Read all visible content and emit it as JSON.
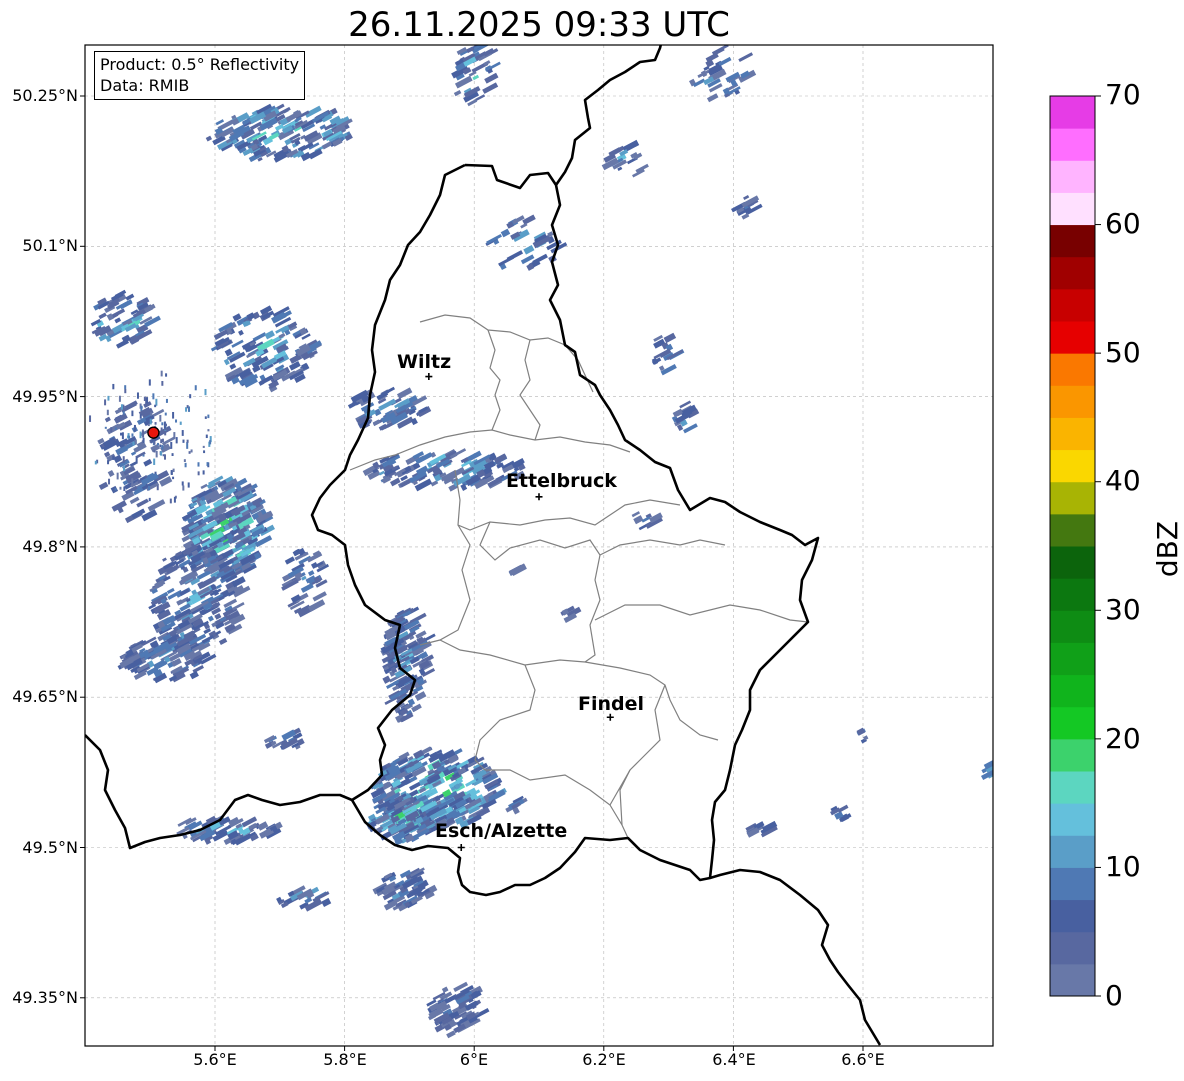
{
  "title": "26.11.2025 09:33 UTC",
  "info": {
    "product": "Product: 0.5° Reflectivity",
    "data": "Data: RMIB"
  },
  "axes": {
    "lat_ticks": [
      "50.25°N",
      "50.1°N",
      "49.95°N",
      "49.8°N",
      "49.65°N",
      "49.5°N",
      "49.35°N"
    ],
    "lon_ticks": [
      "5.6°E",
      "5.8°E",
      "6°E",
      "6.2°E",
      "6.4°E",
      "6.6°E"
    ]
  },
  "cities": [
    {
      "name": "Wiltz",
      "lon": 5.93,
      "lat": 49.97
    },
    {
      "name": "Ettelbruck",
      "lon": 6.1,
      "lat": 49.85
    },
    {
      "name": "Findel",
      "lon": 6.21,
      "lat": 49.63
    },
    {
      "name": "Esch/Alzette",
      "lon": 5.98,
      "lat": 49.5
    }
  ],
  "radar_site": {
    "lon": 5.505,
    "lat": 49.914,
    "color": "#e8160e"
  },
  "colorbar": {
    "label": "dBZ",
    "ticks": [
      "0",
      "10",
      "20",
      "30",
      "40",
      "50",
      "60",
      "70"
    ],
    "colors": [
      "#6878a8",
      "#5868a0",
      "#4860a0",
      "#4f79b4",
      "#5a9ec8",
      "#64c0dc",
      "#5cd6c0",
      "#3cd26c",
      "#14c824",
      "#10b41c",
      "#10a018",
      "#0e8c14",
      "#0c7810",
      "#0c640c",
      "#447810",
      "#a8b404",
      "#fad700",
      "#fab400",
      "#fa9600",
      "#fa7800",
      "#e60000",
      "#c80000",
      "#a00000",
      "#780000",
      "#ffe0ff",
      "#ffb4ff",
      "#ff6eff",
      "#e63ce6"
    ]
  },
  "colors": {
    "border_national": "#000000",
    "border_canton": "#808080",
    "grid": "#b4b4b4"
  }
}
